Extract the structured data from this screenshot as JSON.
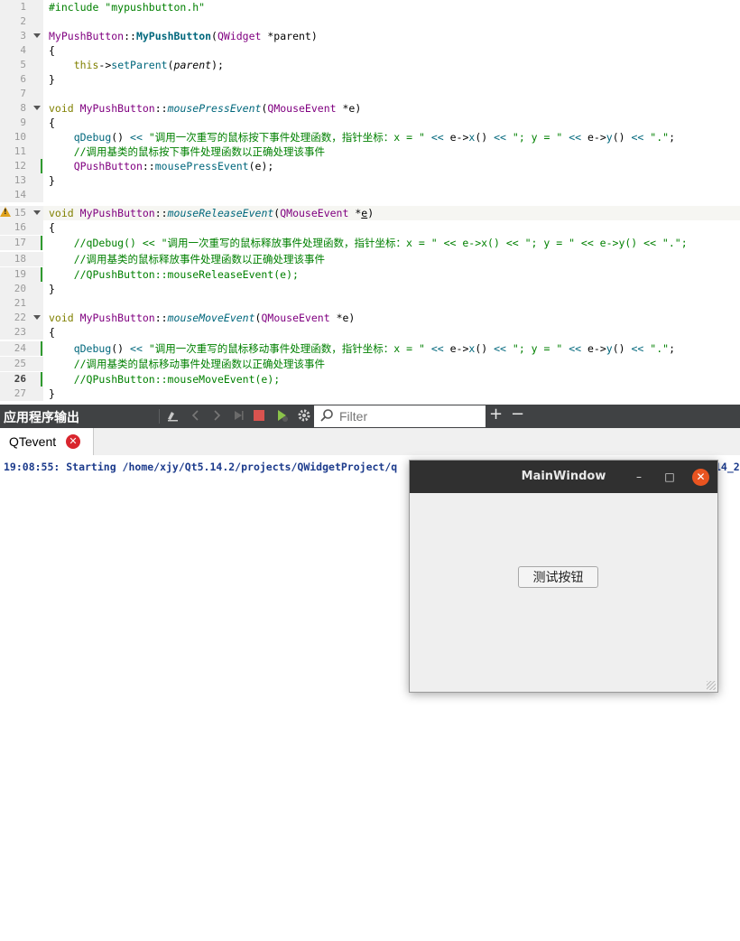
{
  "editor": {
    "line_numbers": [
      "1",
      "2",
      "3",
      "4",
      "5",
      "6",
      "7",
      "8",
      "9",
      "10",
      "11",
      "12",
      "13",
      "14",
      "15",
      "16",
      "17",
      "18",
      "19",
      "20",
      "21",
      "22",
      "23",
      "24",
      "25",
      "26",
      "27"
    ],
    "lines": {
      "l1": [
        "#include \"mypushbutton.h\""
      ],
      "l2": [],
      "l3": [
        "MyPushButton",
        "::",
        "MyPushButton",
        "(",
        "QWidget",
        " *parent)"
      ],
      "l4": [
        "{"
      ],
      "l5": [
        "    ",
        "this",
        "->",
        "setParent",
        "(",
        "parent",
        ");"
      ],
      "l6": [
        "}"
      ],
      "l7": [],
      "l8": [
        "void",
        " ",
        "MyPushButton",
        "::",
        "mousePressEvent",
        "(",
        "QMouseEvent",
        " *e)"
      ],
      "l9": [
        "{"
      ],
      "l10": [
        "    ",
        "qDebug",
        "() ",
        "<<",
        " ",
        "\"调用一次重写的鼠标按下事件处理函数，指针坐标：x = \"",
        " ",
        "<<",
        " e->",
        "x",
        "() ",
        "<<",
        " ",
        "\"; y = \"",
        " ",
        "<<",
        " e->",
        "y",
        "() ",
        "<<",
        " ",
        "\".\"",
        ";"
      ],
      "l11": [
        "    ",
        "//调用基类的鼠标按下事件处理函数以正确处理该事件"
      ],
      "l12": [
        "    ",
        "QPushButton",
        "::",
        "mousePressEvent",
        "(e);"
      ],
      "l13": [
        "}"
      ],
      "l14": [],
      "l15": [
        "void",
        " ",
        "MyPushButton",
        "::",
        "mouseReleaseEvent",
        "(",
        "QMouseEvent",
        " *",
        "e",
        ")"
      ],
      "l16": [
        "{"
      ],
      "l17": [
        "    ",
        "//qDebug() << \"调用一次重写的鼠标释放事件处理函数，指针坐标：x = \" << e->x() << \"; y = \" << e->y() << \".\";"
      ],
      "l18": [
        "    ",
        "//调用基类的鼠标释放事件处理函数以正确处理该事件"
      ],
      "l19": [
        "    ",
        "//QPushButton::mouseReleaseEvent(e);"
      ],
      "l20": [
        "}"
      ],
      "l21": [],
      "l22": [
        "void",
        " ",
        "MyPushButton",
        "::",
        "mouseMoveEvent",
        "(",
        "QMouseEvent",
        " *e)"
      ],
      "l23": [
        "{"
      ],
      "l24": [
        "    ",
        "qDebug",
        "() ",
        "<<",
        " ",
        "\"调用一次重写的鼠标移动事件处理函数，指针坐标：x = \"",
        " ",
        "<<",
        " e->",
        "x",
        "() ",
        "<<",
        " ",
        "\"; y = \"",
        " ",
        "<<",
        " e->",
        "y",
        "() ",
        "<<",
        " ",
        "\".\"",
        ";"
      ],
      "l25": [
        "    ",
        "//调用基类的鼠标移动事件处理函数以正确处理该事件"
      ],
      "l26": [
        "    ",
        "//QPushButton::mouseMoveEvent(e);"
      ],
      "l27": [
        "}"
      ]
    }
  },
  "output_pane": {
    "title": "应用程序输出",
    "filter_placeholder": "Filter",
    "add_label": "+",
    "remove_label": "−"
  },
  "tab": {
    "label": "QTevent",
    "close_label": "✕"
  },
  "output": {
    "line": "19:08:55: Starting /home/xjy/Qt5.14.2/projects/QWidgetProject/q",
    "line_tail": "14_2"
  },
  "main_window": {
    "title": "MainWindow",
    "minimize_label": "–",
    "maximize_label": "□",
    "close_label": "✕",
    "button_label": "测试按钮"
  },
  "colors": {
    "keyword": "#808000",
    "class": "#800080",
    "function": "#00677c",
    "string": "#008000",
    "output_text": "#1c3b8c",
    "title_bar": "#303030",
    "close_button": "#e95420"
  }
}
